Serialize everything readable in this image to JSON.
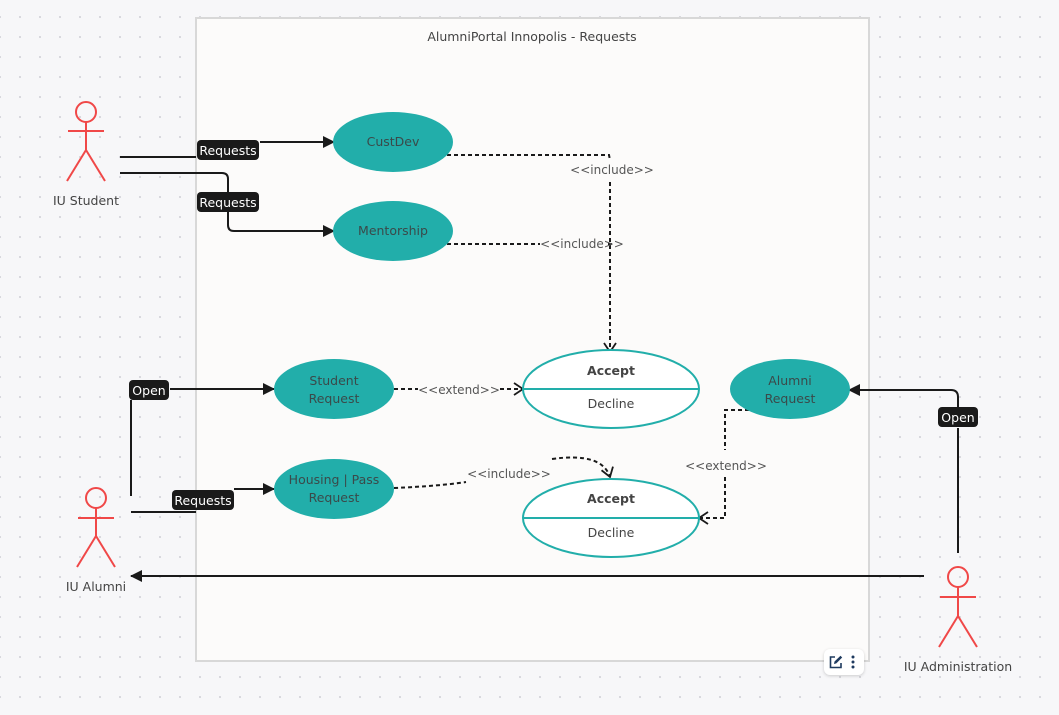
{
  "diagram": {
    "title": "AlumniPortal Innopolis - Requests",
    "colors": {
      "use_case_fill": "#22aeaa",
      "use_case_outline": "#22aeaa",
      "actor": "#f04848",
      "connector": "#1a1a1a",
      "badge_bg": "#1a1a1a",
      "boundary_bg": "#fcfbfa",
      "boundary_border": "#d8d8d8"
    },
    "actors": [
      {
        "id": "student",
        "label": "IU Student"
      },
      {
        "id": "alumni",
        "label": "IU Alumni"
      },
      {
        "id": "admin",
        "label": "IU Administration"
      }
    ],
    "use_cases": [
      {
        "id": "custdev",
        "lines": [
          "CustDev"
        ]
      },
      {
        "id": "mentorship",
        "lines": [
          "Mentorship"
        ]
      },
      {
        "id": "student_request",
        "lines": [
          "Student",
          "Request"
        ]
      },
      {
        "id": "housing_pass",
        "lines": [
          "Housing | Pass",
          "Request"
        ]
      },
      {
        "id": "alumni_request",
        "lines": [
          "Alumni",
          "Request"
        ]
      }
    ],
    "decisions": [
      {
        "id": "decision_1",
        "top": "Accept",
        "bottom": "Decline"
      },
      {
        "id": "decision_2",
        "top": "Accept",
        "bottom": "Decline"
      }
    ],
    "associations": [
      {
        "from": "IU Student",
        "to": "CustDev",
        "label": "Requests"
      },
      {
        "from": "IU Student",
        "to": "Mentorship",
        "label": "Requests"
      },
      {
        "from": "IU Alumni",
        "to": "Student Request",
        "label": "Open"
      },
      {
        "from": "IU Alumni",
        "to": "Housing | Pass Request",
        "label": "Requests"
      },
      {
        "from": "IU Administration",
        "to": "Alumni Request",
        "label": "Open"
      },
      {
        "from": "IU Administration",
        "to": "IU Alumni",
        "label": ""
      }
    ],
    "dependencies": [
      {
        "from": "CustDev",
        "to": "Accept / Decline (1)",
        "label": "<<include>>"
      },
      {
        "from": "Mentorship",
        "to": "Accept / Decline (1)",
        "label": "<<include>>"
      },
      {
        "from": "Student Request",
        "to": "Accept / Decline (1)",
        "label": "<<extend>>"
      },
      {
        "from": "Housing | Pass Request",
        "to": "Accept / Decline (2)",
        "label": "<<include>>"
      },
      {
        "from": "Alumni Request",
        "to": "Accept / Decline (2)",
        "label": "<<extend>>"
      }
    ]
  },
  "toolbar": {
    "edit_icon": "edit-icon",
    "more_icon": "more-vertical-icon"
  }
}
